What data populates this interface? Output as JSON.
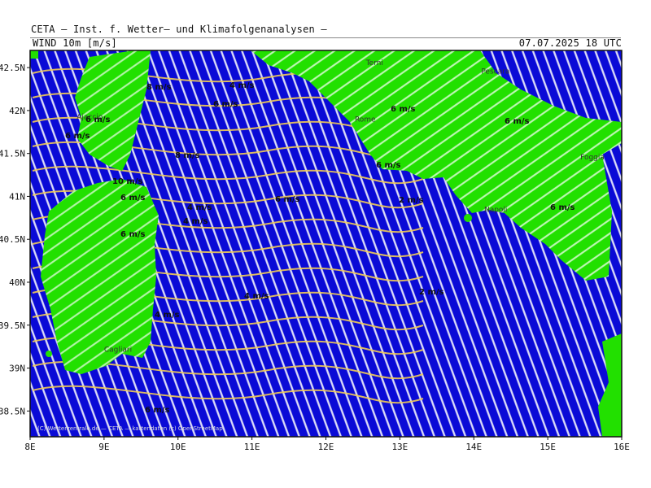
{
  "header": {
    "institute": "CETA — Inst. f. Wetter— und Klimafolgenanalysen —",
    "parameter": "WIND 10m [m/s]",
    "valid_time": "07.07.2025 18 UTC"
  },
  "map": {
    "lon_range": [
      8,
      16
    ],
    "lat_range": [
      38.2,
      42.7
    ],
    "lon_ticks": [
      "8E",
      "9E",
      "10E",
      "11E",
      "12E",
      "13E",
      "14E",
      "15E",
      "16E"
    ],
    "lat_ticks": [
      "42.5N",
      "42N",
      "41.5N",
      "41N",
      "40.5N",
      "40N",
      "39.5N",
      "39N",
      "38.5N"
    ],
    "colors": {
      "sea": "#0a0ad6",
      "land": "#22e000",
      "streamline_white": "#ffffff",
      "streamline_yellow": "#f2cc55",
      "streamline_orange": "#ff9933",
      "frame": "#111111"
    },
    "cities": [
      "Ajaccio",
      "Rome",
      "Terni",
      "Pescara",
      "Foggia",
      "Napoli",
      "Cagliari"
    ],
    "speed_labels": [
      "8 m/s",
      "6 m/s",
      "6 m/s",
      "10 m/s",
      "6 m/s",
      "6 m/s",
      "4 m/s",
      "8 m/s",
      "6 m/s",
      "4 m/s",
      "6 m/s",
      "4 m/s",
      "2 m/s",
      "6 m/s",
      "6 m/s",
      "4 m/s",
      "6 m/s",
      "4 m/s",
      "6 m/s",
      "2 m/s",
      "6 m/s"
    ],
    "footer_text": "(C) Wetterzentrale.de — CETA — kartendaten (c) OpenStreetMap"
  }
}
